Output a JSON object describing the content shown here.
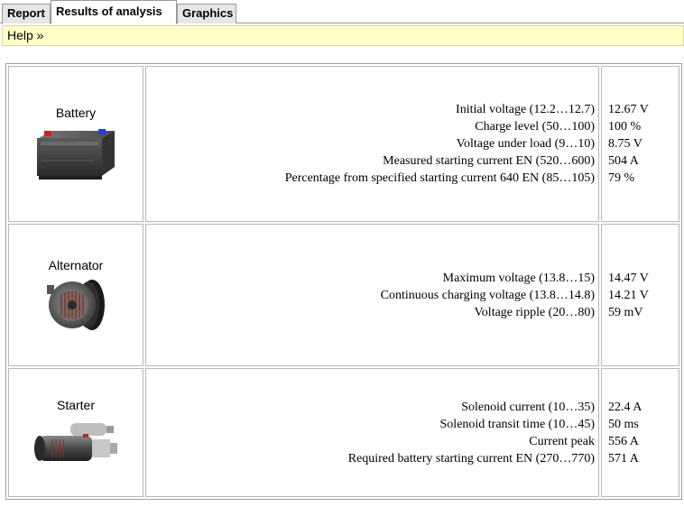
{
  "tabs": [
    {
      "label": "Report"
    },
    {
      "label": "Results of analysis"
    },
    {
      "label": "Graphics"
    }
  ],
  "help": {
    "label": "Help »"
  },
  "components": [
    {
      "name": "Battery",
      "rows": [
        {
          "label": "Initial voltage (12.2…12.7)",
          "value": "12.67 V"
        },
        {
          "label": "Charge level (50…100)",
          "value": "100 %"
        },
        {
          "label": "Voltage under load (9…10)",
          "value": "8.75 V"
        },
        {
          "label": "Measured starting current EN (520…600)",
          "value": "504 A"
        },
        {
          "label": "Percentage from specified starting current 640 EN (85…105)",
          "value": "79 %"
        }
      ]
    },
    {
      "name": "Alternator",
      "rows": [
        {
          "label": "Maximum voltage (13.8…15)",
          "value": "14.47 V"
        },
        {
          "label": "Continuous charging voltage (13.8…14.8)",
          "value": "14.21 V"
        },
        {
          "label": "Voltage ripple (20…80)",
          "value": "59 mV"
        }
      ]
    },
    {
      "name": "Starter",
      "rows": [
        {
          "label": "Solenoid current (10…35)",
          "value": "22.4 A"
        },
        {
          "label": "Solenoid transit time (10…45)",
          "value": "50 ms"
        },
        {
          "label": "Current peak",
          "value": "556 A"
        },
        {
          "label": "Required battery starting current EN (270…770)",
          "value": "571 A"
        }
      ]
    }
  ]
}
